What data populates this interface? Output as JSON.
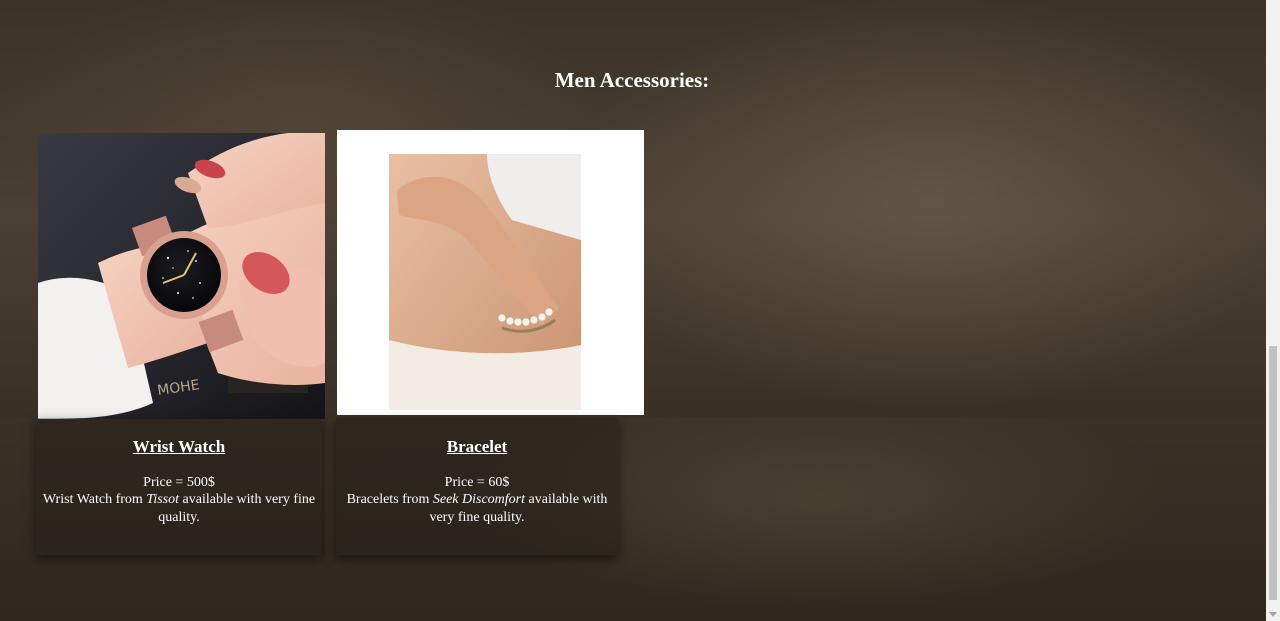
{
  "section": {
    "heading": "Men Accessories:"
  },
  "products": [
    {
      "title": "Wrist Watch",
      "price": "Price = 500$",
      "desc_before": "Wrist Watch from ",
      "brand": "Tissot",
      "desc_after": " available with very fine quality."
    },
    {
      "title": "Bracelet",
      "price": "Price = 60$",
      "desc_before": "Bracelets from ",
      "brand": "Seek Discomfort",
      "desc_after": " available with very fine quality."
    }
  ],
  "icons": {
    "watch_image": "wrist-watch-photo",
    "bracelet_image": "bracelet-photo"
  }
}
